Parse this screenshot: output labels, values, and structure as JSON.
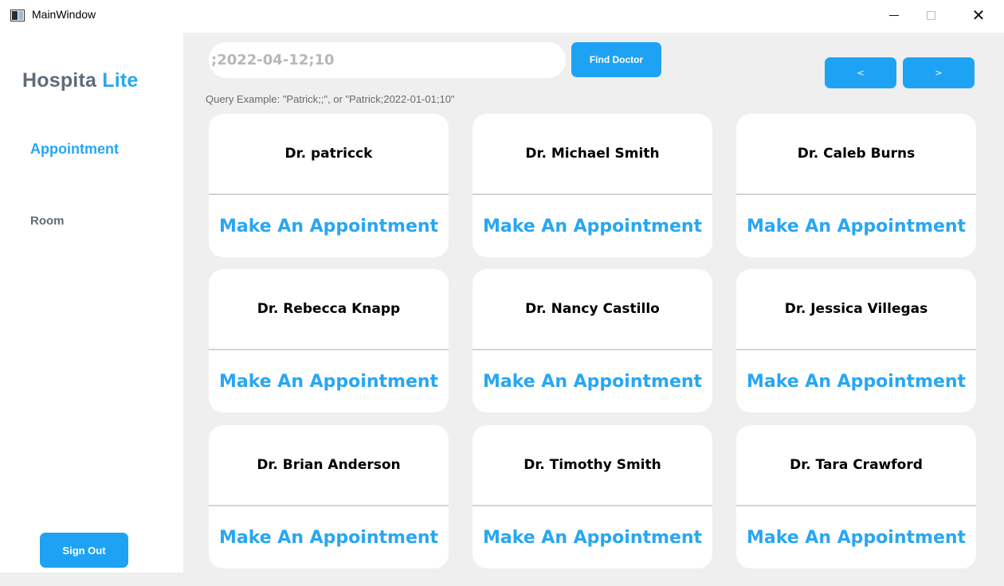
{
  "window": {
    "title": "MainWindow"
  },
  "sidebar": {
    "logo_part1": "Hospita",
    "logo_part2": "Lite",
    "nav": [
      {
        "label": "Appointment",
        "active": true
      },
      {
        "label": "Room",
        "active": false
      }
    ],
    "sign_out_label": "Sign Out"
  },
  "search": {
    "value": ";2022-04-12;10",
    "find_label": "Find Doctor",
    "hint": "Query Example: \"Patrick;;\", or \"Patrick;2022-01-01;10\""
  },
  "pagination": {
    "prev_label": "<",
    "next_label": ">"
  },
  "doctors": [
    {
      "name": "Dr. patricck",
      "action": "Make An Appointment"
    },
    {
      "name": "Dr. Michael Smith",
      "action": "Make An Appointment"
    },
    {
      "name": "Dr. Caleb Burns",
      "action": "Make An Appointment"
    },
    {
      "name": "Dr. Rebecca Knapp",
      "action": "Make An Appointment"
    },
    {
      "name": "Dr. Nancy Castillo",
      "action": "Make An Appointment"
    },
    {
      "name": "Dr. Jessica Villegas",
      "action": "Make An Appointment"
    },
    {
      "name": "Dr. Brian Anderson",
      "action": "Make An Appointment"
    },
    {
      "name": "Dr. Timothy Smith",
      "action": "Make An Appointment"
    },
    {
      "name": "Dr. Tara Crawford",
      "action": "Make An Appointment"
    }
  ],
  "colors": {
    "accent": "#1ea3f4",
    "accent_text": "#29a6f2",
    "logo_gray": "#5f6b7a",
    "panel_bg": "#efefef"
  },
  "icons": {
    "app": "app-window-icon",
    "minimize": "minimize-icon",
    "maximize": "maximize-icon",
    "close": "close-icon"
  }
}
